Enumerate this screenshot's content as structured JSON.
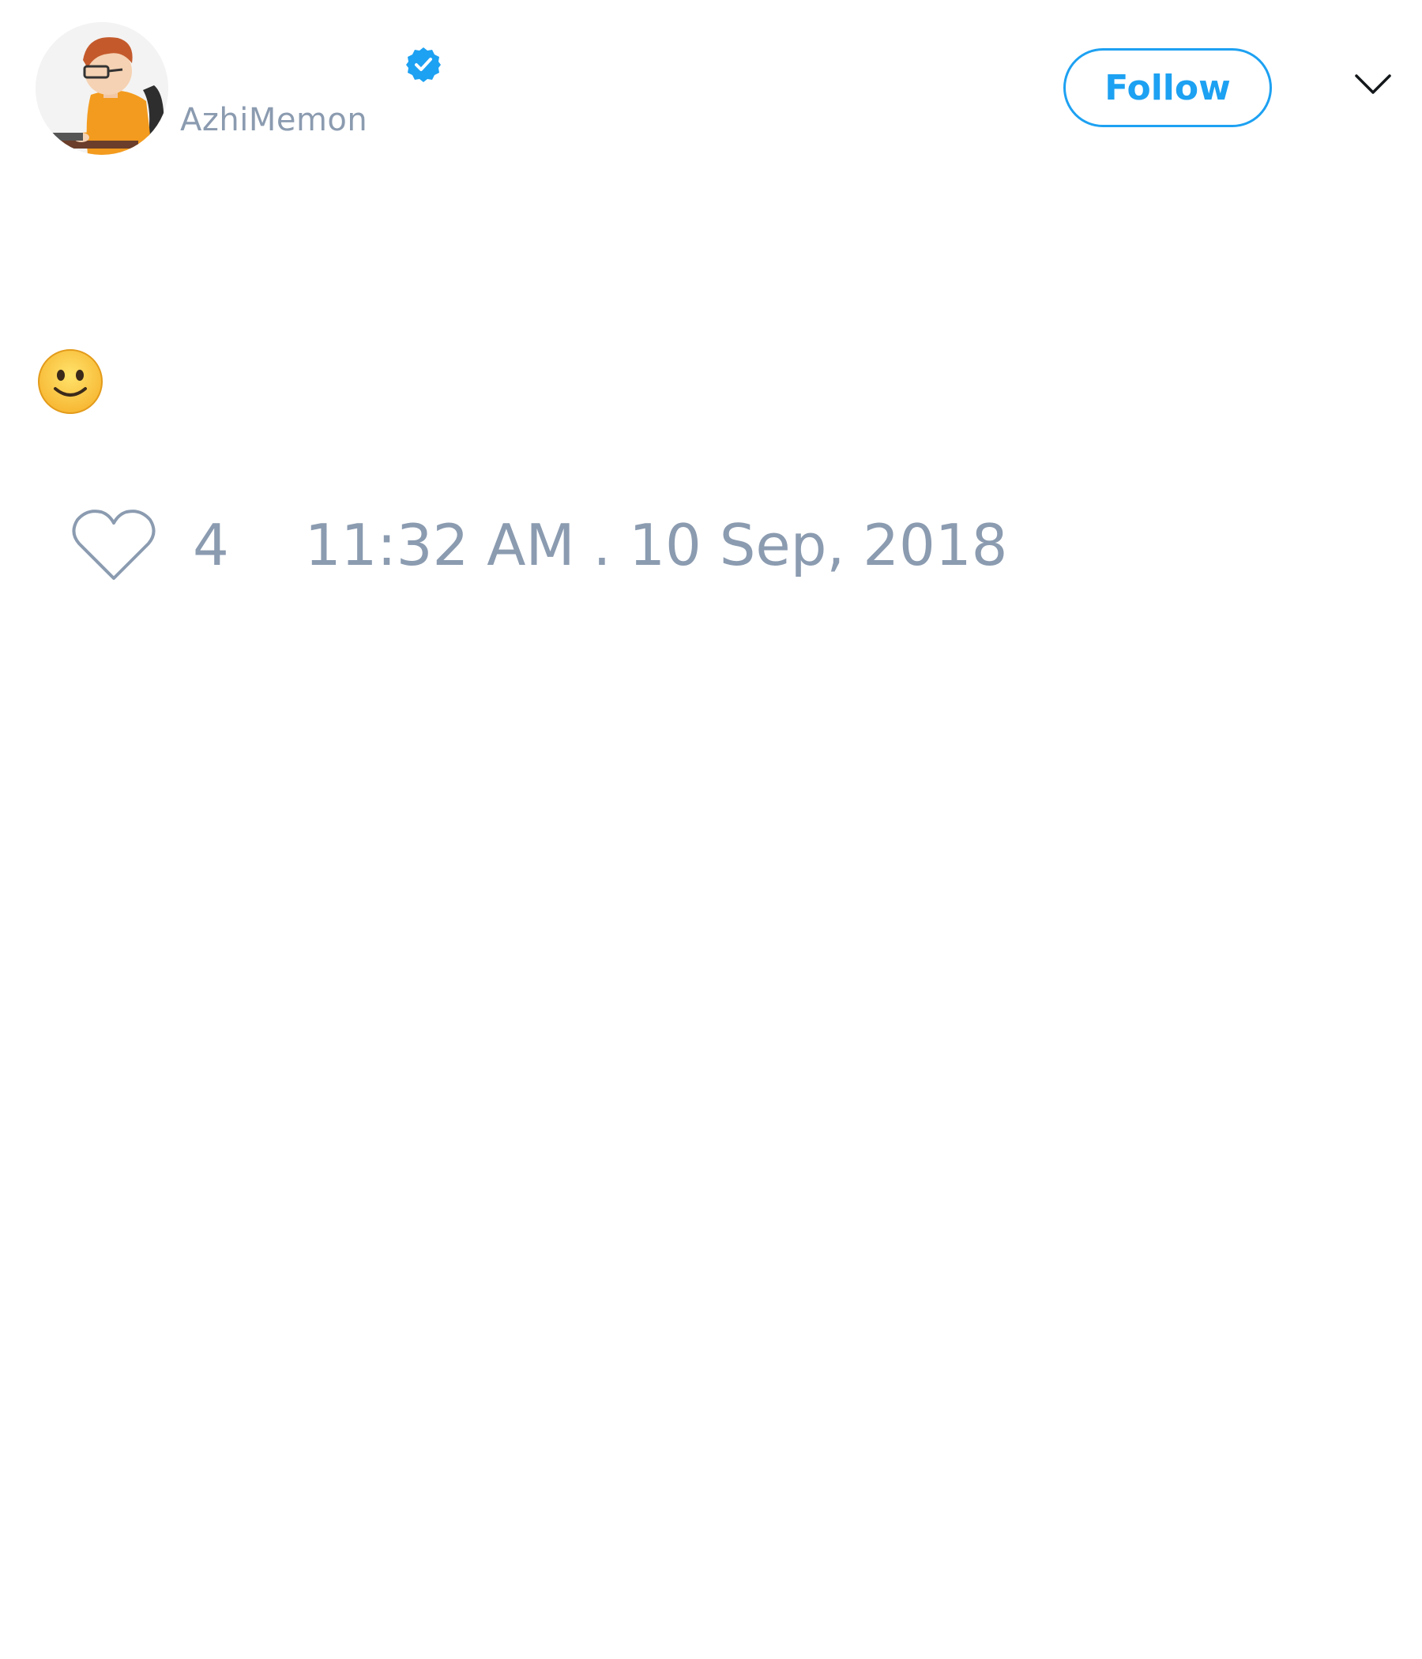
{
  "tweet": {
    "author": {
      "handle": "AzhiMemon",
      "verified": true,
      "avatar_icon": "developer-at-desk-avatar"
    },
    "follow_button": {
      "label": "Follow",
      "accent_color": "#1da1f2"
    },
    "menu_icon": "chevron-down-icon",
    "content_icon": "slightly-smiling-face-emoji",
    "like_icon": "heart-outline-icon",
    "likes": "4",
    "timestamp": "11:32 AM . 10 Sep, 2018",
    "meta_color": "#8b9bb0"
  }
}
